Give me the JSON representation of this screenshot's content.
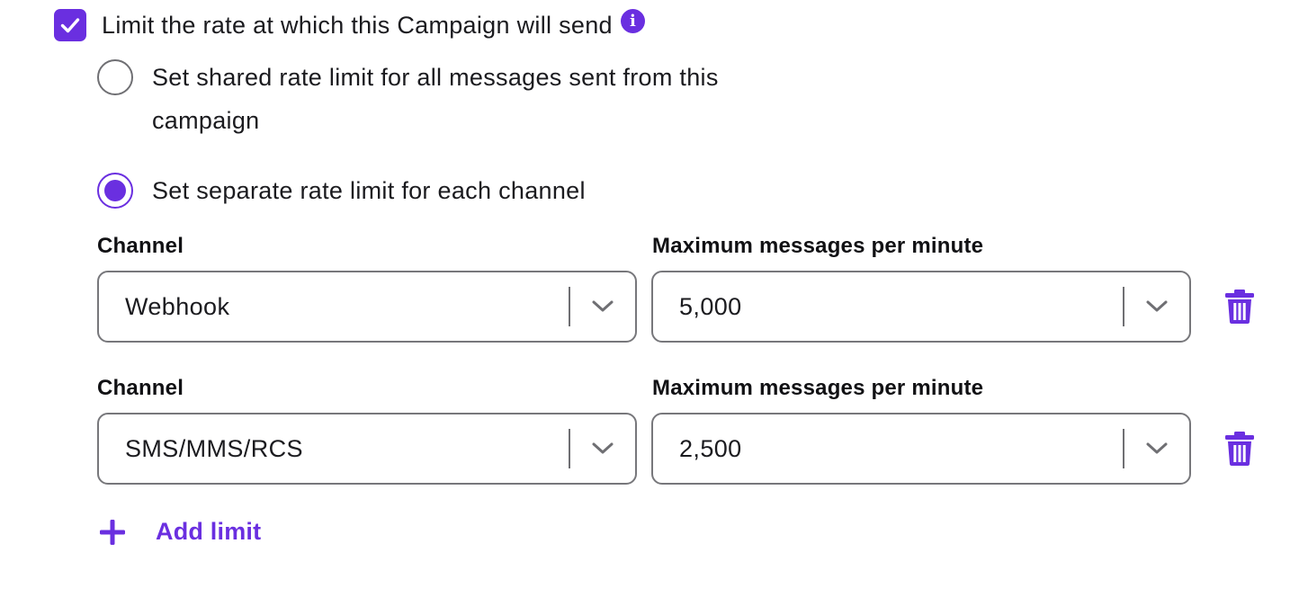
{
  "colors": {
    "accent": "#6a2fe0",
    "text": "#1b1b1f",
    "border": "#77777b"
  },
  "rate_limit": {
    "checkbox_checked": true,
    "checkbox_label": "Limit the rate at which this Campaign will send",
    "info_icon": "info-icon",
    "info_glyph": "i"
  },
  "options": {
    "shared": {
      "label": "Set shared rate limit for all messages sent from this campaign",
      "selected": false
    },
    "separate": {
      "label": "Set separate rate limit for each channel",
      "selected": true
    }
  },
  "limits": [
    {
      "channel_label": "Channel",
      "channel_value": "Webhook",
      "max_label": "Maximum messages per minute",
      "max_value": "5,000",
      "delete_icon": "trash-icon"
    },
    {
      "channel_label": "Channel",
      "channel_value": "SMS/MMS/RCS",
      "max_label": "Maximum messages per minute",
      "max_value": "2,500",
      "delete_icon": "trash-icon"
    }
  ],
  "add_limit": {
    "label": "Add limit",
    "icon": "plus-icon"
  }
}
